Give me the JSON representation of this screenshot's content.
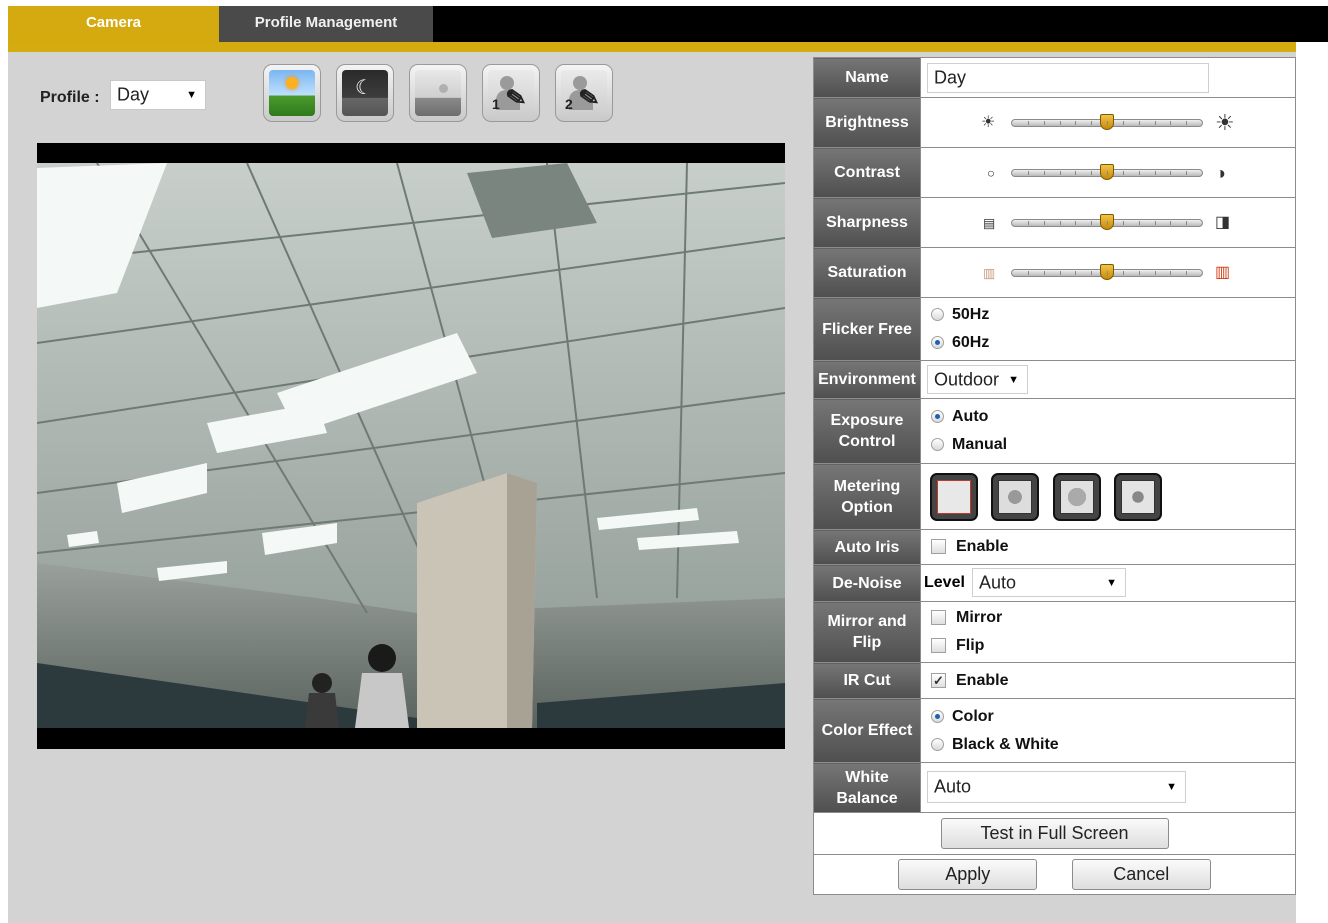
{
  "tabs": [
    {
      "label": "Camera",
      "active": true
    },
    {
      "label": "Profile Management",
      "active": false
    }
  ],
  "colors": {
    "accent": "#d4ac10",
    "label_bg": "#5f5f5f",
    "selected_radio": "#1e5fb4"
  },
  "profile": {
    "label": "Profile :",
    "value": "Day"
  },
  "presets": [
    {
      "icon": "sun-landscape-icon"
    },
    {
      "icon": "moon-night-icon"
    },
    {
      "icon": "dusk-landscape-icon"
    },
    {
      "icon": "custom-profile-1-icon",
      "number": "1"
    },
    {
      "icon": "custom-profile-2-icon",
      "number": "2"
    }
  ],
  "video": {
    "content": "ceiling-office-camera-feed"
  },
  "settings": {
    "name": {
      "label": "Name",
      "value": "Day"
    },
    "brightness": {
      "label": "Brightness",
      "level": 0.5
    },
    "contrast": {
      "label": "Contrast",
      "level": 0.5
    },
    "sharpness": {
      "label": "Sharpness",
      "level": 0.5
    },
    "saturation": {
      "label": "Saturation",
      "level": 0.5
    },
    "flicker": {
      "label": "Flicker Free",
      "options": [
        "50Hz",
        "60Hz"
      ],
      "selected": "60Hz"
    },
    "environment": {
      "label": "Environment",
      "value": "Outdoor"
    },
    "exposure": {
      "label1": "Exposure",
      "label2": "Control",
      "options": [
        "Auto",
        "Manual"
      ],
      "selected": "Auto"
    },
    "metering": {
      "label1": "Metering",
      "label2": "Option"
    },
    "auto_iris": {
      "label": "Auto Iris",
      "option": "Enable",
      "checked": false
    },
    "denoise": {
      "label": "De-Noise",
      "level_label": "Level",
      "value": "Auto"
    },
    "mirror_flip": {
      "label1": "Mirror and",
      "label2": "Flip",
      "mirror": "Mirror",
      "flip": "Flip",
      "mirror_checked": false,
      "flip_checked": false
    },
    "ir_cut": {
      "label": "IR Cut",
      "option": "Enable",
      "checked": true
    },
    "color_effect": {
      "label": "Color Effect",
      "options": [
        "Color",
        "Black & White"
      ],
      "selected": "Color"
    },
    "white_balance": {
      "label1": "White",
      "label2": "Balance",
      "value": "Auto"
    }
  },
  "buttons": {
    "test_full_screen": "Test in Full Screen",
    "apply": "Apply",
    "cancel": "Cancel"
  }
}
